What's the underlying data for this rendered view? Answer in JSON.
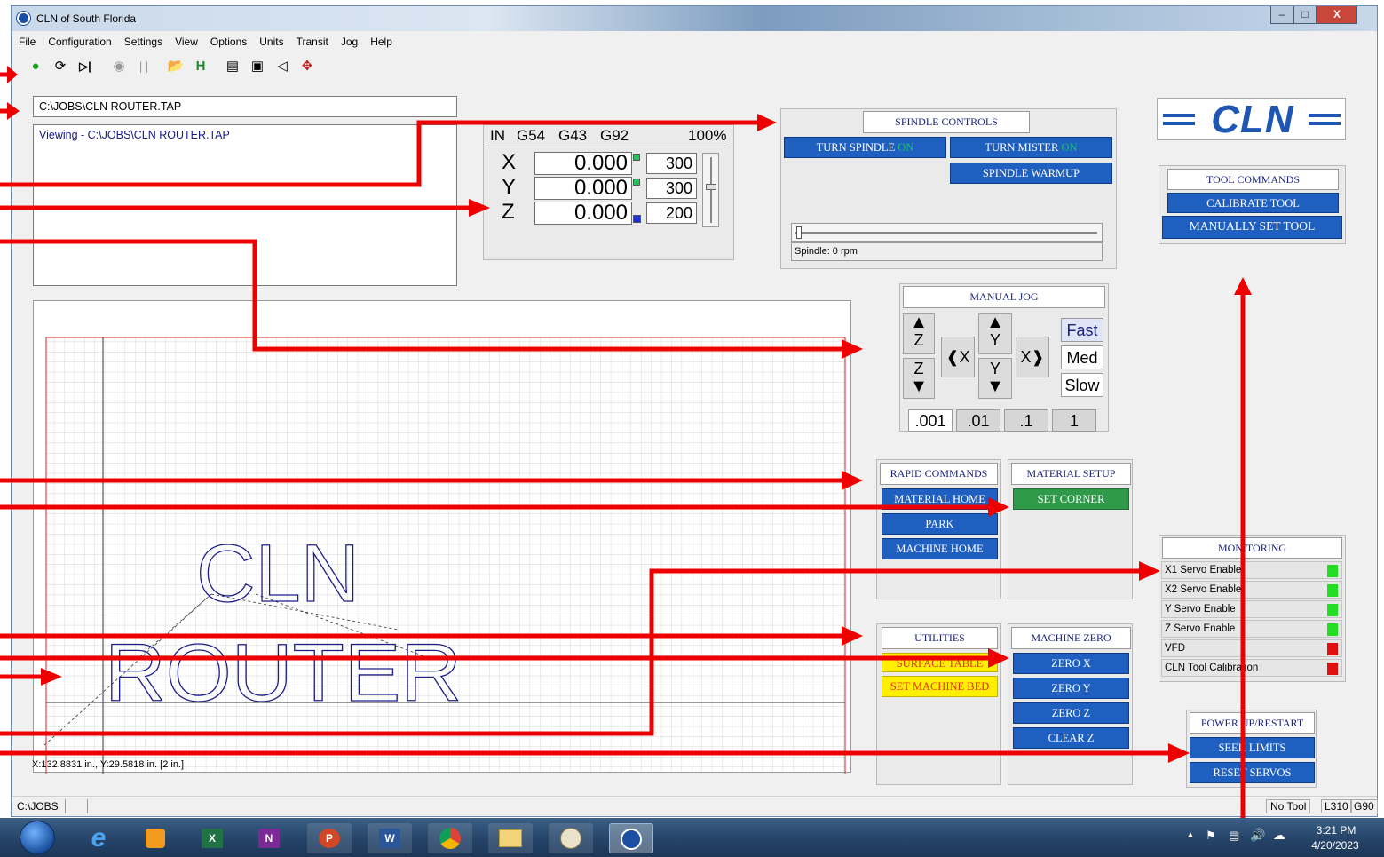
{
  "window": {
    "title": "CLN of South Florida"
  },
  "menu": [
    "File",
    "Configuration",
    "Settings",
    "View",
    "Options",
    "Units",
    "Transit",
    "Jog",
    "Help"
  ],
  "toolbar_icons": [
    "start-icon",
    "refresh-icon",
    "step-icon",
    "stop-icon",
    "pause-icon",
    "open-folder-icon",
    "home-h-icon",
    "list-icon",
    "window-icon",
    "back-arrow-icon",
    "move-cross-icon"
  ],
  "file": {
    "path": "C:\\JOBS\\CLN ROUTER.TAP",
    "viewing": "Viewing - C:\\JOBS\\CLN ROUTER.TAP"
  },
  "dro": {
    "header": {
      "units": "IN",
      "g1": "G54",
      "g2": "G43",
      "g3": "G92",
      "pct": "100%"
    },
    "axes": [
      {
        "label": "X",
        "value": "0.000",
        "feed": "300",
        "led": "#22c55e"
      },
      {
        "label": "Y",
        "value": "0.000",
        "feed": "300",
        "led": "#22c55e"
      },
      {
        "label": "Z",
        "value": "0.000",
        "feed": "200",
        "led": "#1d31d6"
      }
    ]
  },
  "spindle": {
    "title": "SPINDLE CONTROLS",
    "turn_spindle": "TURN SPINDLE",
    "turn_mister": "TURN MISTER",
    "on": "ON",
    "warmup": "SPINDLE WARMUP",
    "status": "Spindle: 0 rpm"
  },
  "logo": "CLN",
  "tool_commands": {
    "title": "TOOL COMMANDS",
    "calibrate": "CALIBRATE TOOL",
    "manual": "MANUALLY SET TOOL"
  },
  "manual_jog": {
    "title": "MANUAL JOG",
    "z": "Z",
    "y": "Y",
    "x": "X",
    "speeds": [
      "Fast",
      "Med",
      "Slow"
    ],
    "increments": [
      ".001",
      ".01",
      ".1",
      "1"
    ]
  },
  "rapid": {
    "title": "RAPID COMMANDS",
    "buttons": [
      "MATERIAL HOME",
      "PARK",
      "MACHINE HOME"
    ]
  },
  "material_setup": {
    "title": "MATERIAL SETUP",
    "set_corner": "SET CORNER"
  },
  "utilities": {
    "title": "UTILITIES",
    "surface": "SURFACE TABLE",
    "machine_bed": "SET MACHINE BED"
  },
  "machine_zero": {
    "title": "MACHINE ZERO",
    "buttons": [
      "ZERO X",
      "ZERO Y",
      "ZERO Z",
      "CLEAR Z"
    ]
  },
  "monitoring": {
    "title": "MONITORING",
    "rows": [
      {
        "label": "X1 Servo Enable",
        "color": "#22dd22"
      },
      {
        "label": "X2 Servo Enable",
        "color": "#22dd22"
      },
      {
        "label": "Y Servo Enable",
        "color": "#22dd22"
      },
      {
        "label": "Z Servo Enable",
        "color": "#22dd22"
      },
      {
        "label": "VFD",
        "color": "#e01010"
      },
      {
        "label": "CLN Tool Calibration",
        "color": "#e01010"
      }
    ]
  },
  "power": {
    "title": "POWER UP/RESTART",
    "seek": "SEEK LIMITS",
    "reset": "RESET SERVOS"
  },
  "canvas": {
    "coords": "X:132.8831 in., Y:29.5818 in. [2 in.]",
    "text_top": "CLN",
    "text_bottom": "ROUTER"
  },
  "statusbar": {
    "path": "C:\\JOBS",
    "tool": "No Tool",
    "line": "L310",
    "mode": "G90"
  },
  "taskbar": {
    "time": "3:21 PM",
    "date": "4/20/2023"
  }
}
